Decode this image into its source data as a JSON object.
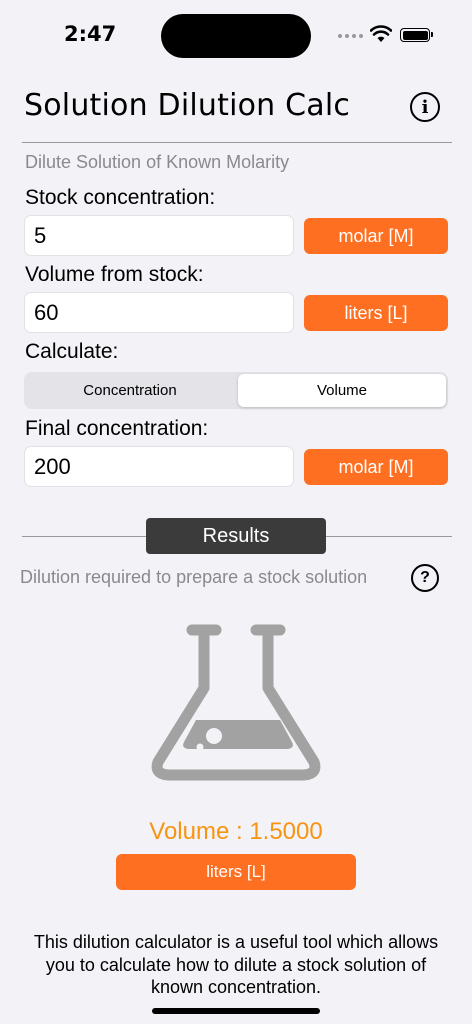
{
  "status": {
    "time": "2:47"
  },
  "header": {
    "title": "Solution Dilution Calc"
  },
  "subtitle": "Dilute Solution of Known Molarity",
  "stock": {
    "label": "Stock concentration:",
    "value": "5",
    "unit": "molar [M]"
  },
  "volume": {
    "label": "Volume from stock:",
    "value": "60",
    "unit": "liters [L]"
  },
  "calculate": {
    "label": "Calculate:",
    "options": [
      "Concentration",
      "Volume"
    ],
    "selected": "Volume"
  },
  "final": {
    "label": "Final concentration:",
    "value": "200",
    "unit": "molar [M]"
  },
  "results": {
    "tag": "Results",
    "description": "Dilution required to prepare a stock solution",
    "value_text": "Volume : 1.5000",
    "unit": "liters [L]"
  },
  "footer": "This dilution calculator is a useful tool which allows you to calculate how to dilute a stock solution of known concentration.",
  "colors": {
    "accent": "#fe6f21",
    "result": "#f79411",
    "background": "#f2f2f7"
  }
}
